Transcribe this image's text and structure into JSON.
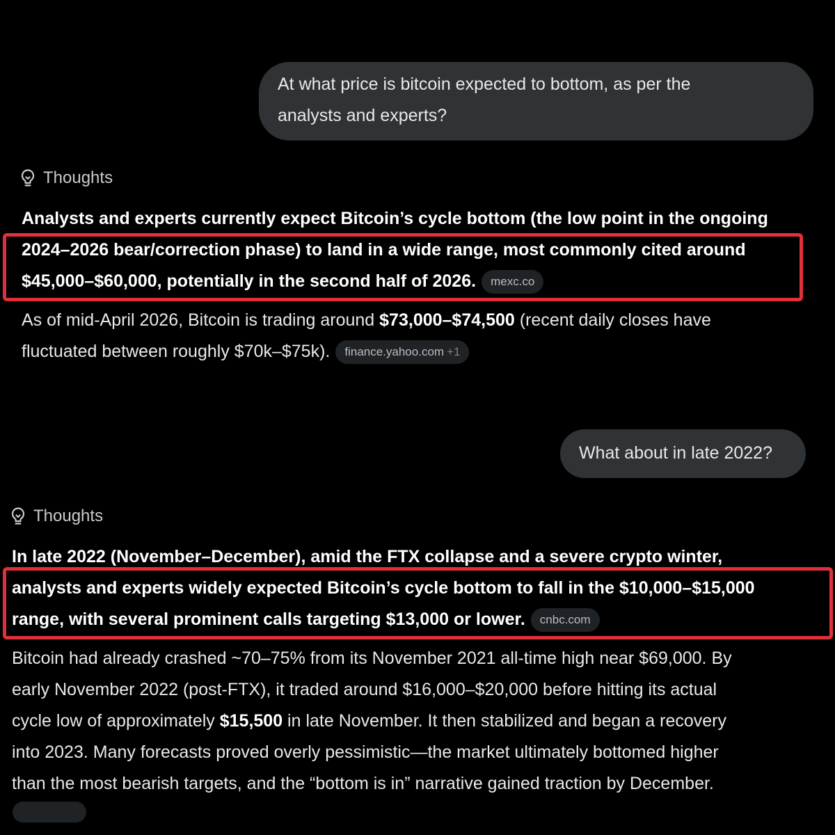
{
  "conversation": {
    "user_message_1": {
      "line1": "At what price is bitcoin expected to bottom, as per the",
      "line2": "analysts and experts?"
    },
    "thoughts_label_1": "Thoughts",
    "answer_1": {
      "bold_line1": "Analysts and experts currently expect Bitcoin’s cycle bottom (the low point in the ongoing",
      "bold_line2": "2024–2026 bear/correction phase) to land in a wide range, most commonly cited around",
      "bold_line3": "$45,000–$60,000, potentially in the second half of 2026.",
      "source": "mexc.co",
      "detail_line1_pre": "As of mid-April 2026, Bitcoin is trading around ",
      "detail_line1_bold": "$73,000–$74,500",
      "detail_line1_post": " (recent daily closes have",
      "detail_line2": "fluctuated between roughly $70k–$75k).",
      "detail_source": "finance.yahoo.com",
      "detail_source_extra": "+1"
    },
    "user_message_2": "What about in late 2022?",
    "thoughts_label_2": "Thoughts",
    "answer_2": {
      "bold_line1": "In late 2022 (November–December), amid the FTX collapse and a severe crypto winter,",
      "bold_line2": "analysts and experts widely expected Bitcoin’s cycle bottom to fall in the $10,000–$15,000",
      "bold_line3": "range, with several prominent calls targeting $13,000 or lower.",
      "source": "cnbc.com",
      "detail_line1": "Bitcoin had already crashed ~70–75% from its November 2021 all-time high near $69,000. By",
      "detail_line2": "early November 2022 (post-FTX), it traded around $16,000–$20,000 before hitting its actual",
      "detail_line3_pre": "cycle low of approximately ",
      "detail_line3_bold": "$15,500",
      "detail_line3_post": " in late November. It then stabilized and began a recovery",
      "detail_line4": "into 2023. Many forecasts proved overly pessimistic—the market ultimately bottomed higher",
      "detail_line5": "than the most bearish targets, and the “bottom is in” narrative gained traction by December."
    }
  },
  "colors": {
    "background": "#000000",
    "bubble": "#2f3336",
    "text": "#e7e9ea",
    "highlight_border": "#e0303a",
    "chip": "#1f2326"
  },
  "icons": {
    "thoughts": "lightbulb-icon"
  }
}
